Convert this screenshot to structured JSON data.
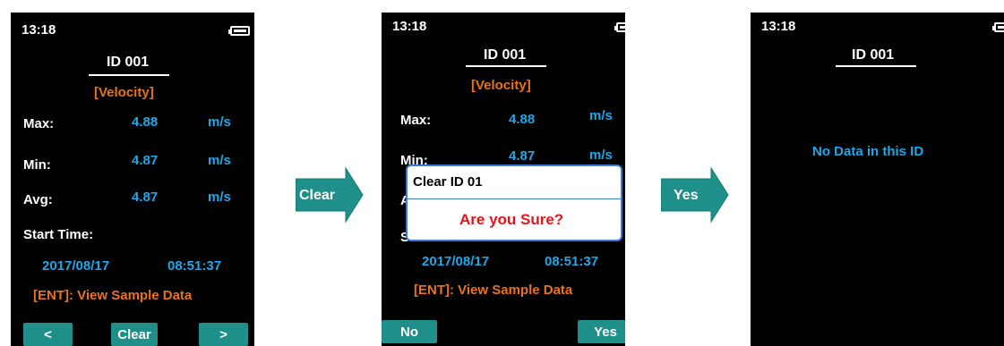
{
  "arrows": {
    "clear_label": "Clear",
    "yes_label": "Yes"
  },
  "colors": {
    "accent_blue": "#1ea8ea",
    "accent_orange": "#e8731c",
    "softkey_teal": "#1f8f8a",
    "dialog_red": "#e5141b",
    "arrow_fill": "#1f8f8a"
  },
  "screen1": {
    "time": "13:18",
    "id_title": "ID 001",
    "mode": "[Velocity]",
    "rows": [
      {
        "label": "Max:",
        "value": "4.88",
        "unit": "m/s"
      },
      {
        "label": "Min:",
        "value": "4.87",
        "unit": "m/s"
      },
      {
        "label": "Avg:",
        "value": "4.87",
        "unit": "m/s"
      }
    ],
    "start_time_label": "Start Time:",
    "date": "2017/08/17",
    "clock": "08:51:37",
    "hint": "[ENT]: View Sample Data",
    "softkeys": {
      "left": "<",
      "middle": "Clear",
      "right": ">"
    }
  },
  "screen2": {
    "time": "13:18",
    "id_title": "ID 001",
    "mode": "[Velocity]",
    "rows": [
      {
        "label": "Max:",
        "value": "4.88",
        "unit": "m/s"
      },
      {
        "label": "Min:",
        "value": "4.87",
        "unit": "m/s"
      }
    ],
    "partial_avg": "A",
    "partial_start": "S",
    "date": "2017/08/17",
    "clock": "08:51:37",
    "hint": "[ENT]: View Sample Data",
    "dialog": {
      "title": "Clear ID 01",
      "message": "Are you Sure?"
    },
    "softkeys": {
      "left": "No",
      "right": "Yes"
    }
  },
  "screen3": {
    "time": "13:18",
    "id_title": "ID 001",
    "message": "No Data in this ID"
  }
}
